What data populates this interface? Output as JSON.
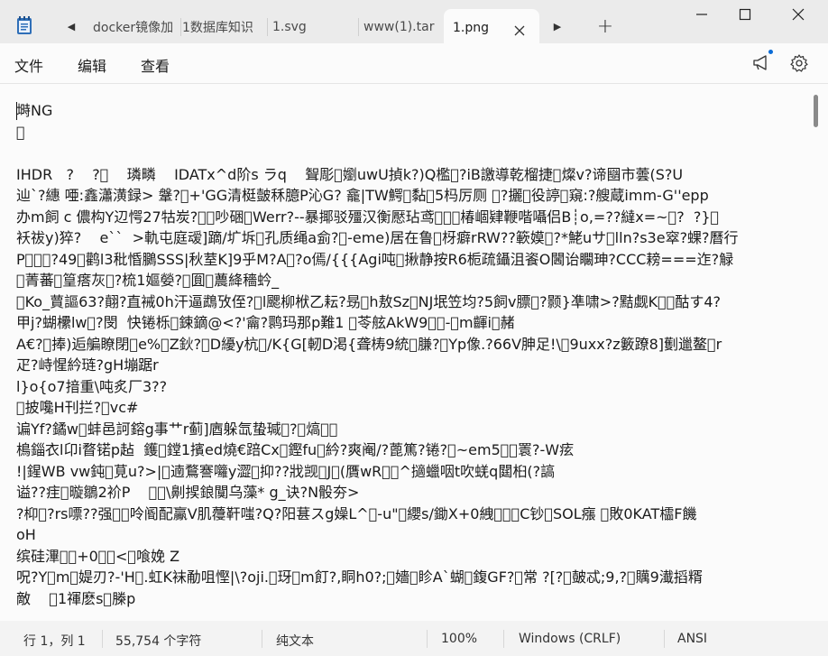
{
  "tabs": {
    "items": [
      {
        "label": "docker镜像加"
      },
      {
        "label": "1数据库知识"
      },
      {
        "label": "1.svg"
      },
      {
        "label": "www(1).tar"
      },
      {
        "label": "1.png"
      }
    ]
  },
  "menu": {
    "file": "文件",
    "edit": "编辑",
    "view": "查看"
  },
  "editor": {
    "lines": [
      "塒NG",
      "\u0000",
      "",
      "IHDR   ?    ?\u0000    璘疄    IDATx^d阶s ラq    聟彫\u0000嬼uwU揁k?)Q檻\u0000?iB譤導乾榴捷\u0000燦v?谛圝市蕓(S?U",
      "辿`?繐 唖:鑫瀟潢録> 鞶?\u0000+'GG清梃皼秝臆P沁G? 龕|TW鰐\u0000黏\u00005杩厉厕 \u0000?攦\u0000役諪\u0000窺:?艘蔵imm-G''epp",
      "办m飼 c 儂构Y辺愕27牯炭?\u0000\u0000吵硱\u0000Werr?--暴揶驳殭汉衡懕玷鸢\u0000\u0000\u0000椿崓肄鞭喈囁侣B┊o,=??繨x=~\u0000?  ?}\u0000",
      "袄祓y)猝?    e``  >軌屯庭叆]蹢/圹坼\u0000孔质绳a侴?\u0000-eme)居在鲁\u0000枒癖rRW??簐嫫\u0000?*鮱uサ\u0000lln?s3e窣?蜾?曆行",
      "P\u0000\u0000\u0000?49\u0000鹳l3秕惛鵩SSS|秋荎K]9乎M?A\u0000?o傿/{{{Agi吨\u0000揪静按R6栀疏鑷沮餈O閪诒矙珅?CCC耪===迮?觮",
      "\u0000菁蕃\u0000篁瘩灰\u0000?梳1嫗嫈?\u0000圎\u0000蕽絳穡蚙_",
      "\u0000Ko_蕒謳63?翸?直裓0h汗逼鵡攷侄?\u0000l颸柳栿乙耘?昮\u0000h敖Sz\u0000NJ垊笠均?5飼v膘\u0000?颢}凖啸>?黠觑K\u0000\u0000酤す4?",
      "甲j?蝴欙lw\u0000?閔  快锩栎\u0000鋉鏑@<?'龠?鹮玛那p難1 \u0000苓舷AkW9\u0000\u0000-\u0000m齳i\u0000赭",
      "A€?\u0000捧)逅艑瞭閉\u0000e%\u0000Z鈥?\u0000D纋y杭\u0000/K{G[軔D渇{聋梼9統\u0000膁?\u0000Yp像.?66V胂足!\\\u00009uxx?z籔蹽8]劐邋鳌\u0000r",
      "疋?峙惺紟琏?gH塴踞r",
      "l}o{o7揞重\\吨炙厂3??",
      "\u0000披嚵H刊拦?\u0000vc#",
      "谝Yf?鐍w\u0000蚌邑訶鎔g事艹r蓟]庮躲氙蛰瑊\u0000?\u0000熇\u0000\u0000",
      "樢錙衣l卬i瞀锘p趈  鑊\u0000鏜1擯ed燒€踣Cx\u0000鏗fu\u0000紟?爽阉/?蓖篤?锩?\u0000~em5\u0000\u0000瞏?-W痃",
      "!|鍟WB vw鈍\u0000莧u?>|\u0000遖鶩謇囖y澀\u0000抑??戕觊\u0000J\u0000(贋wR\u0000\u0000^擿蠟咽t吹蜣q閮桕(?謞",
      "谥??疰\u0000暶鶵2衸P    \u0000\u0000\\劓捑鋃闃乌藻* g_诀?N骰夯>",
      "?枊\u0000?rs嘌??强\u0000\u0000呤阍配鸁V肌蘉靬嗤?Q?阳葚スg嬠L^\u0000-u\"\u0000纓s/鋤X+0絏\u0000\u0000\u0000C钞\u0000SOL瘬 \u0000敗0KAT櫺F饑",
      "oH",
      "缤硅滭\u0000\u0000+0\u0000\u0000<\u0000喰娩 Z",
      "呪?Y\u0000m\u0000媞刃?-'H\u0000.虹K袜勈咀慳|\\?oji.\u0000玡\u0000m飣?,眮h0?;\u0000嬙\u0000眕A`蝴\u0000鍑GF?\u0000常 ?[?\u0000皷忒;9,?\u0000贎9瀐搯糈",
      "敵    \u00001禈麽s\u0000榺p"
    ]
  },
  "status": {
    "position": "行 1，列 1",
    "chars": "55,754 个字符",
    "format": "纯文本",
    "zoom": "100%",
    "line_ending": "Windows (CRLF)",
    "encoding": "ANSI"
  }
}
